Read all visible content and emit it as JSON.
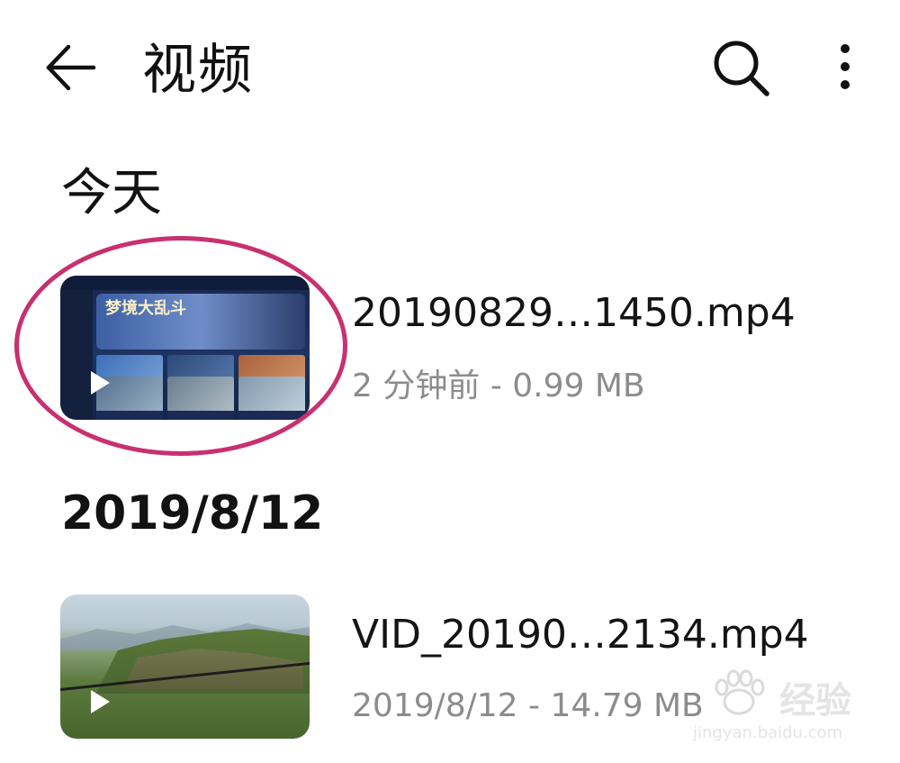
{
  "appbar": {
    "title": "视频",
    "back_icon": "arrow-left-icon",
    "search_icon": "search-icon",
    "more_icon": "more-vert-icon"
  },
  "sections": [
    {
      "header": "今天",
      "items": [
        {
          "filename": "20190829…1450.mp4",
          "meta": "2 分钟前 - 0.99 MB",
          "thumbnail": "game-screenshot-thumbnail",
          "thumb_text": "梦境大乱斗"
        }
      ]
    },
    {
      "header": "2019/8/12",
      "items": [
        {
          "filename": "VID_20190…2134.mp4",
          "meta": "2019/8/12 - 14.79 MB",
          "thumbnail": "mountain-landscape-thumbnail"
        }
      ]
    }
  ],
  "annotation": {
    "color": "#c9306f"
  },
  "watermark": {
    "text": "经验",
    "url": "jingyan.baidu.com"
  },
  "colors": {
    "text": "#141414",
    "secondary": "#8c8c8c",
    "background": "#ffffff"
  }
}
